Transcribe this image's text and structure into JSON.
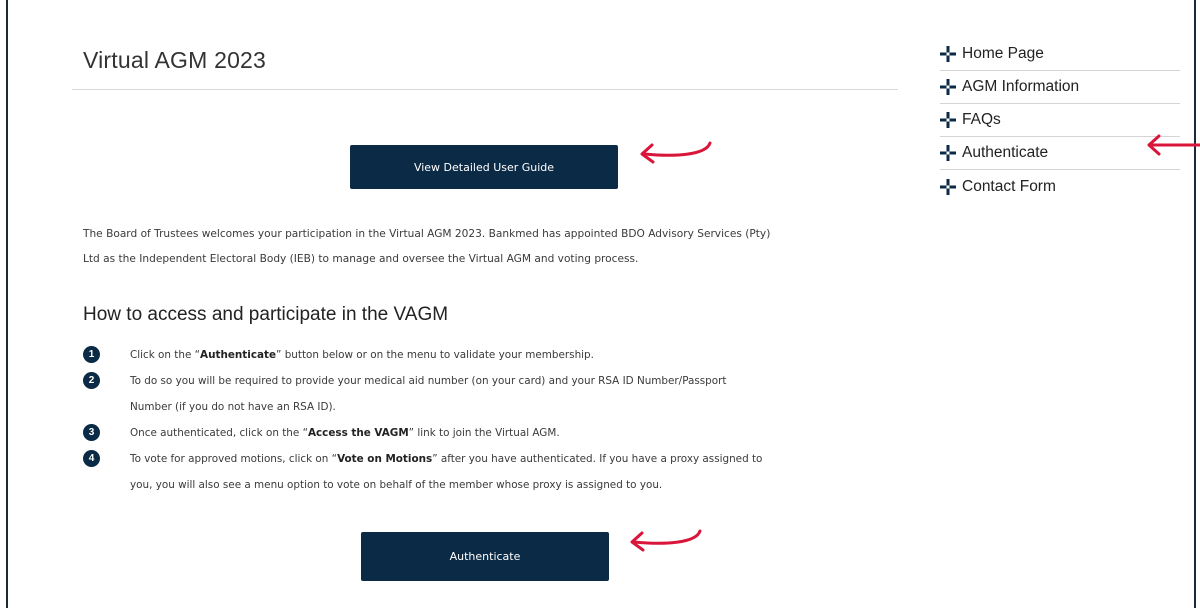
{
  "page": {
    "title": "Virtual AGM 2023"
  },
  "buttons": {
    "guide_label": "View Detailed User Guide",
    "authenticate_label": "Authenticate"
  },
  "intro": {
    "line1": "The Board of Trustees welcomes your participation in the Virtual AGM 2023. Bankmed has appointed BDO Advisory Services (Pty)",
    "line2": "Ltd as the Independent Electoral Body (IEB) to manage and oversee the Virtual AGM and voting process."
  },
  "section": {
    "heading": "How to access and participate in the VAGM"
  },
  "steps": [
    {
      "num": "1",
      "pre": "Click on the “",
      "bold": "Authenticate",
      "post": "” button below or on the menu to validate your membership."
    },
    {
      "num": "2",
      "line1": "To do so you will be required to provide your medical aid number (on your card) and your RSA ID Number/Passport",
      "line2": "Number (if you do not have an RSA ID)."
    },
    {
      "num": "3",
      "pre": "Once authenticated, click on the “",
      "bold": "Access the VAGM",
      "post": "” link to join the Virtual AGM."
    },
    {
      "num": "4",
      "pre": "To vote for approved motions, click on “",
      "bold": "Vote on Motions",
      "post": "” after you have authenticated. If you have a proxy assigned to",
      "line2": "you, you will also see a menu option to vote on behalf of the member whose proxy is assigned to you."
    }
  ],
  "sidebar": {
    "items": [
      {
        "label": "Home Page"
      },
      {
        "label": "AGM Information"
      },
      {
        "label": "FAQs"
      },
      {
        "label": "Authenticate"
      },
      {
        "label": "Contact Form"
      }
    ]
  },
  "colors": {
    "button_bg": "#0b2a45",
    "annotation_arrow": "#d9163a",
    "frame_border": "#1a2a3a"
  },
  "icons": {
    "menu_bullet": "plus-cross-icon",
    "annotation": "curved-arrow-left-icon"
  }
}
